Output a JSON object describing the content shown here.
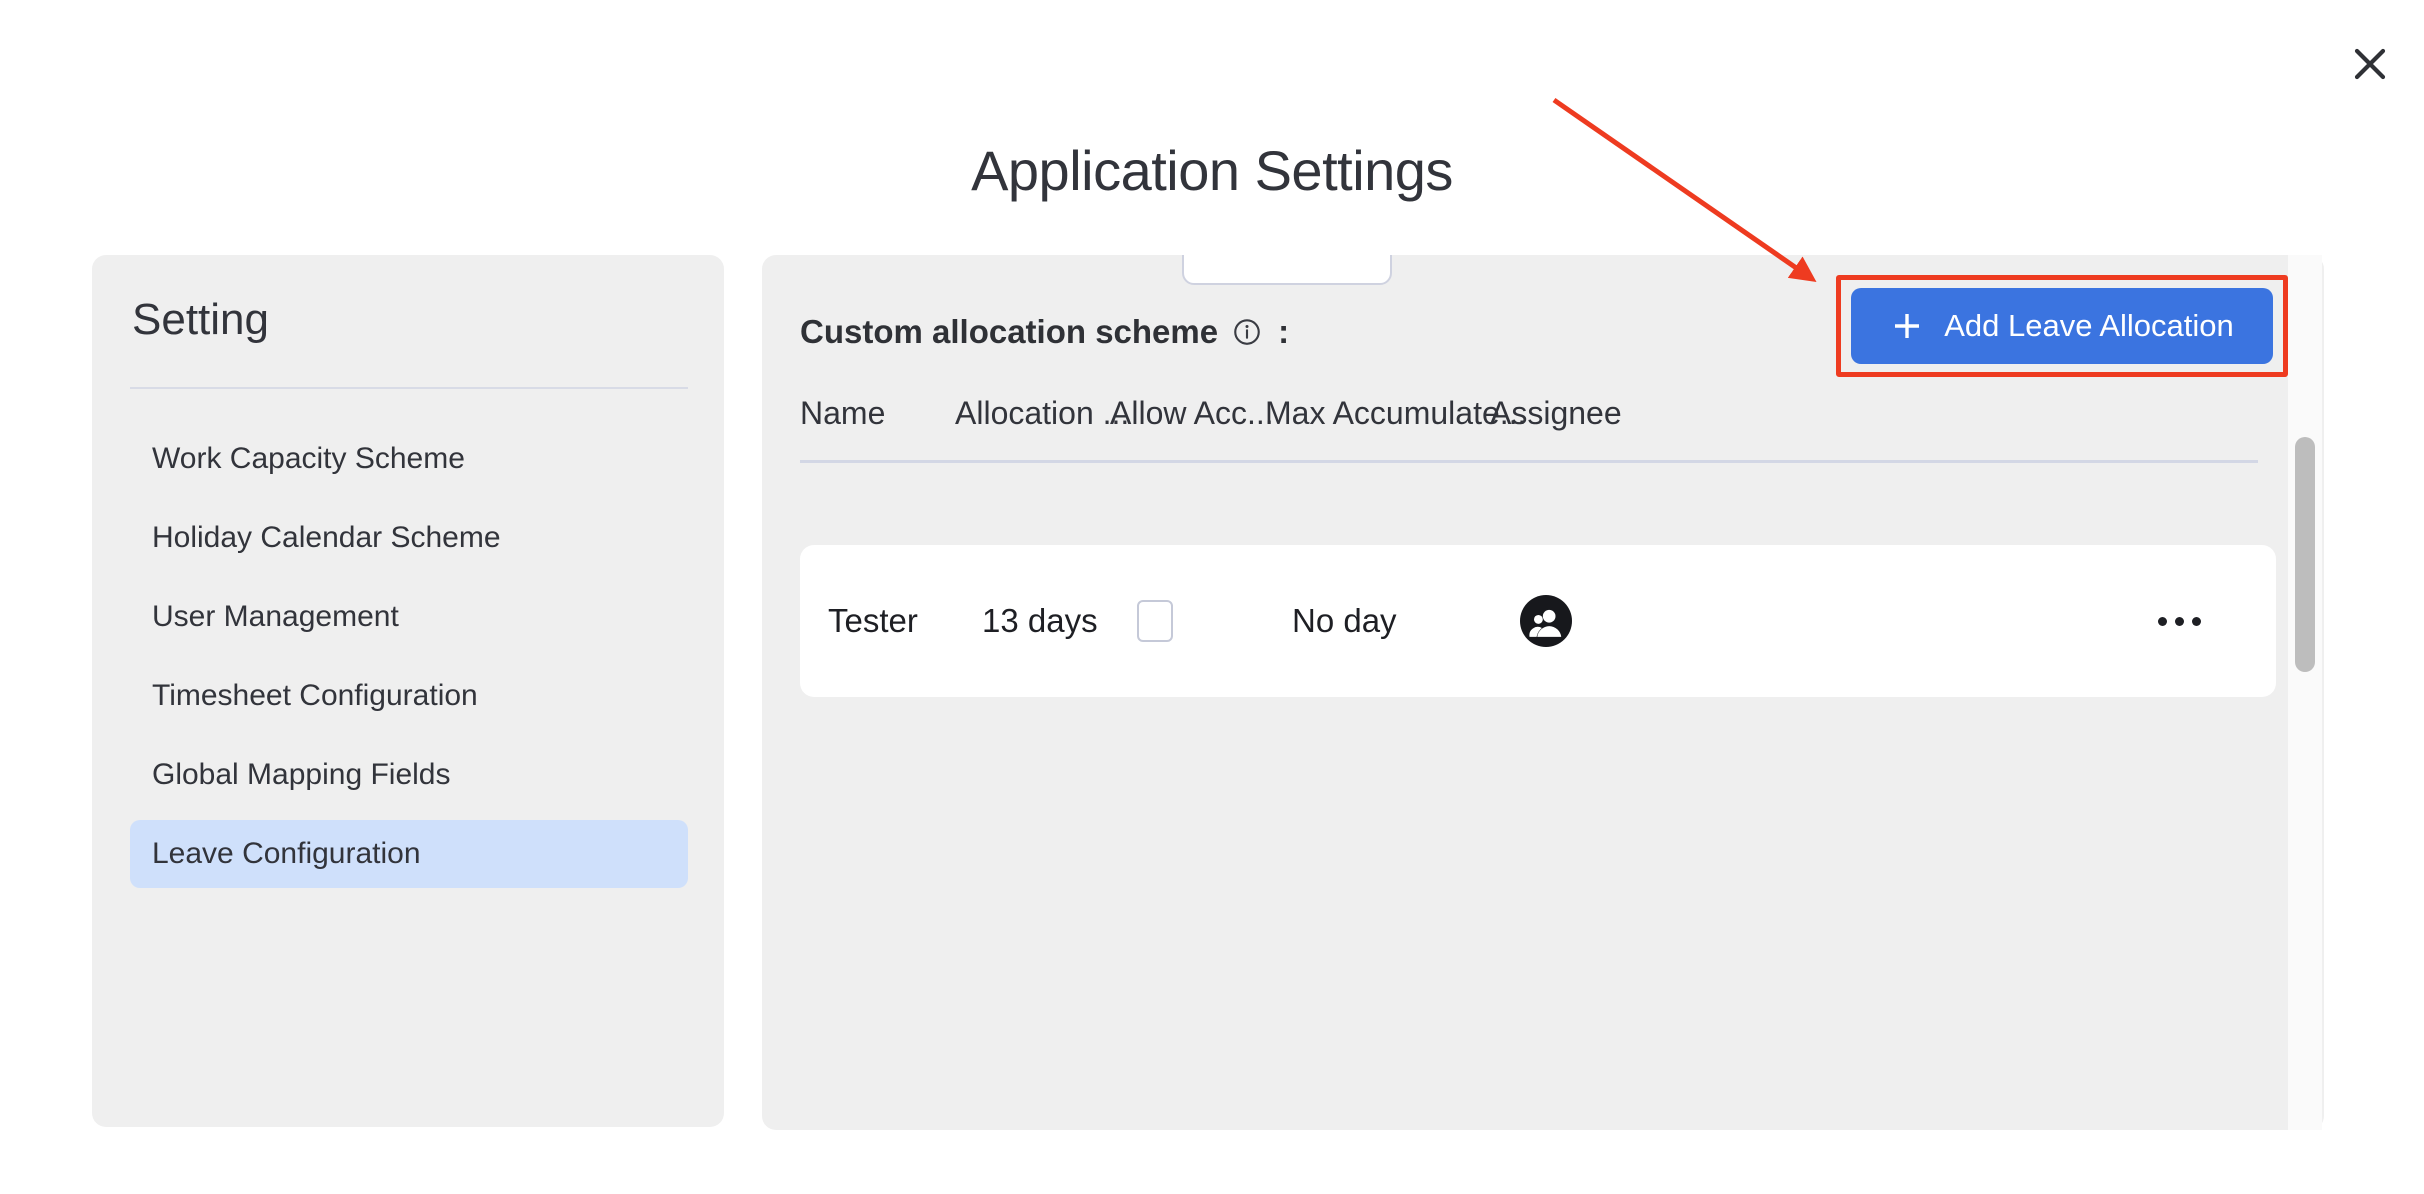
{
  "window": {
    "title": "Application Settings",
    "close_label": "close-icon"
  },
  "sidebar": {
    "title": "Setting",
    "items": [
      {
        "label": "Work Capacity Scheme",
        "active": false
      },
      {
        "label": "Holiday Calendar Scheme",
        "active": false
      },
      {
        "label": "User Management",
        "active": false
      },
      {
        "label": "Timesheet Configuration",
        "active": false
      },
      {
        "label": "Global Mapping Fields",
        "active": false
      },
      {
        "label": "Leave Configuration",
        "active": true
      }
    ]
  },
  "content": {
    "section_label": "Custom allocation scheme",
    "section_colon": ":",
    "info_icon": "info-circle-icon",
    "add_button": {
      "label": "Add Leave Allocation",
      "icon": "plus-icon",
      "color": "#3b74e0",
      "highlight_color": "#ee3b20"
    },
    "table": {
      "columns": [
        "Name",
        "Allocation ...",
        "Allow Acc...",
        "Max Accumulate...",
        "Assignee"
      ],
      "rows": [
        {
          "name": "Tester",
          "allocation": "13 days",
          "allow_accumulate": false,
          "max_accumulated": "No day",
          "assignee_icon": "people-group-avatar",
          "actions_icon": "kebab-menu-icon"
        }
      ]
    }
  },
  "annotation": {
    "arrow_color": "#ee3b20",
    "arrow_note": "points to Add Leave Allocation button"
  }
}
